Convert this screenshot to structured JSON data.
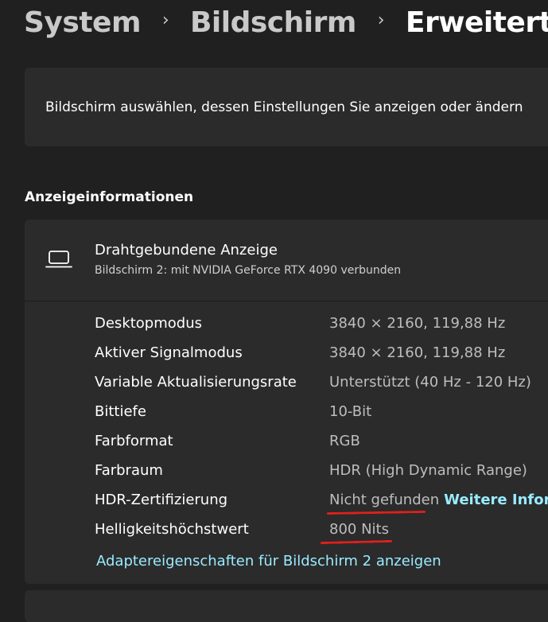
{
  "breadcrumb": {
    "items": [
      "System",
      "Bildschirm"
    ],
    "current": "Erweiterte",
    "separator": "›"
  },
  "select_display": {
    "text": "Bildschirm auswählen, dessen Einstellungen Sie anzeigen oder ändern"
  },
  "section": {
    "heading": "Anzeigeinformationen"
  },
  "display_info": {
    "icon": "laptop-icon",
    "title": "Drahtgebundene Anzeige",
    "subtitle": "Bildschirm 2: mit NVIDIA GeForce RTX 4090 verbunden",
    "rows": [
      {
        "label": "Desktopmodus",
        "value": "3840 × 2160, 119,88 Hz"
      },
      {
        "label": "Aktiver Signalmodus",
        "value": "3840 × 2160, 119,88 Hz"
      },
      {
        "label": "Variable Aktualisierungsrate",
        "value": "Unterstützt (40 Hz - 120 Hz)"
      },
      {
        "label": "Bittiefe",
        "value": "10-Bit"
      },
      {
        "label": "Farbformat",
        "value": "RGB"
      },
      {
        "label": "Farbraum",
        "value": "HDR (High Dynamic Range)"
      },
      {
        "label": "HDR-Zertifizierung",
        "value": "Nicht gefunden",
        "link": "Weitere Informationen"
      },
      {
        "label": "Helligkeitshöchstwert",
        "value": "800 Nits"
      }
    ],
    "adapter_link": "Adaptereigenschaften für Bildschirm 2 anzeigen"
  },
  "colors": {
    "background": "#202020",
    "card": "#2b2b2b",
    "link": "#99ebff",
    "annotation_underline": "#e0201b"
  }
}
